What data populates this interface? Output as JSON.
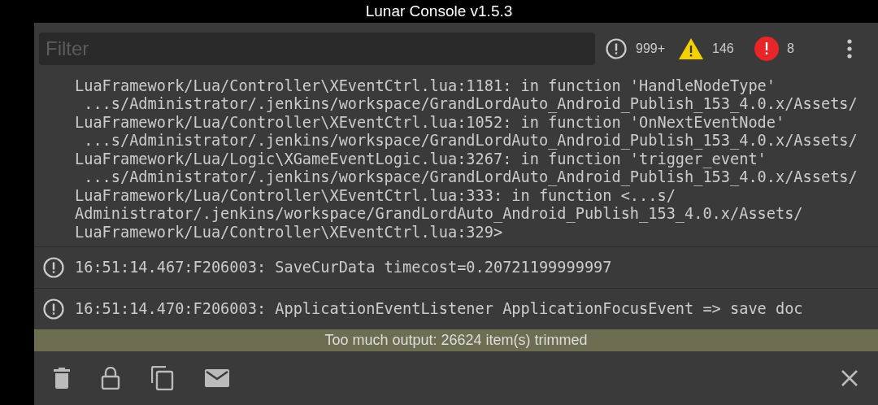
{
  "window": {
    "title": "Lunar Console v1.5.3"
  },
  "filter": {
    "placeholder": "Filter"
  },
  "counters": [
    {
      "kind": "log",
      "count": "999+"
    },
    {
      "kind": "warning",
      "count": "146"
    },
    {
      "kind": "error",
      "count": "8"
    }
  ],
  "entries": [
    {
      "kind": "continuation",
      "lines": [
        "LuaFramework/Lua/Controller\\XEventCtrl.lua:1181: in function 'HandleNodeType'",
        " ...s/Administrator/.jenkins/workspace/GrandLordAuto_Android_Publish_153_4.0.x/Assets/",
        "LuaFramework/Lua/Controller\\XEventCtrl.lua:1052: in function 'OnNextEventNode'",
        " ...s/Administrator/.jenkins/workspace/GrandLordAuto_Android_Publish_153_4.0.x/Assets/",
        "LuaFramework/Lua/Logic\\XGameEventLogic.lua:3267: in function 'trigger_event'",
        " ...s/Administrator/.jenkins/workspace/GrandLordAuto_Android_Publish_153_4.0.x/Assets/",
        "LuaFramework/Lua/Controller\\XEventCtrl.lua:333: in function <...s/",
        "Administrator/.jenkins/workspace/GrandLordAuto_Android_Publish_153_4.0.x/Assets/",
        "LuaFramework/Lua/Controller\\XEventCtrl.lua:329>"
      ]
    },
    {
      "kind": "log",
      "lines": [
        "16:51:14.467:F206003: SaveCurData timecost=0.20721199999997"
      ]
    },
    {
      "kind": "log",
      "lines": [
        "16:51:14.470:F206003: ApplicationEventListener ApplicationFocusEvent => save doc"
      ]
    }
  ],
  "trimmed_notice": "Too much output: 26624 item(s) trimmed",
  "toolbar": [
    {
      "kind": "clear"
    },
    {
      "kind": "lock"
    },
    {
      "kind": "copy"
    },
    {
      "kind": "email"
    }
  ]
}
